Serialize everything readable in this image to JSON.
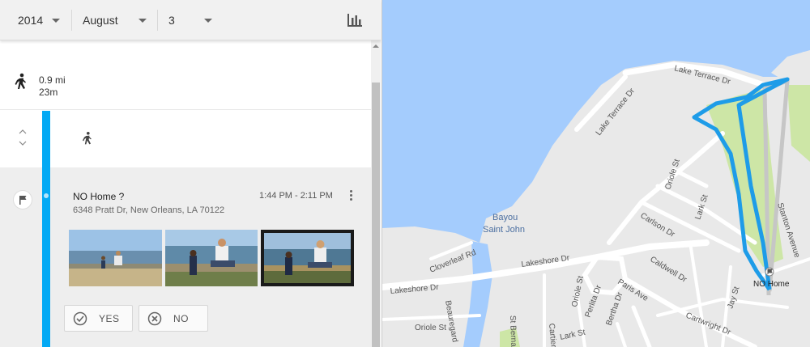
{
  "toolbar": {
    "year": "2014",
    "month": "August",
    "day": "3",
    "chart_icon": "bar-chart-icon"
  },
  "timeline": {
    "walk_segment": {
      "icon": "walk-icon",
      "distance": "0.9 mi",
      "duration": "23m"
    },
    "collapsed_segment": {
      "icon": "walk-icon"
    },
    "place": {
      "icon": "flag-icon",
      "name": "NO Home ?",
      "time_range": "1:44 PM - 2:11 PM",
      "address": "6348 Pratt Dr, New Orleans, LA 70122",
      "photos": [
        "photo-1",
        "photo-2",
        "photo-3"
      ],
      "yes_label": "YES",
      "no_label": "NO"
    }
  },
  "map": {
    "labels": {
      "lake_terrace_dr_top": "Lake Terrace Dr",
      "lake_terrace_dr_diag": "Lake Terrace Dr",
      "bayou": "Bayou",
      "saint_john": "Saint John",
      "lakeshore_dr_main": "Lakeshore Dr",
      "lakeshore_dr_left": "Lakeshore Dr",
      "cloverleaf": "Cloverleaf Rd",
      "beauregard": "Beauregard",
      "oriole_st_left": "Oriole St",
      "st_bernard": "St Bernard",
      "oriole_st": "Oriole St",
      "lark_st": "Lark St",
      "carlson_dr": "Carlson Dr",
      "caldwell_dr": "Caldwell Dr",
      "paris_ave": "Paris Ave",
      "perlita_dr": "Perlita Dr",
      "bertha_dr": "Bertha Dr",
      "oriole_st_bottom": "Oriole St",
      "lark_st_bottom": "Lark St",
      "cartwright_dr": "Cartwright Dr",
      "jay_st": "Jay St",
      "stanton_avenue": "Stanton Avenue",
      "cartier": "Cartier",
      "no_home_marker": "NO Home"
    },
    "colors": {
      "water": "#a4ccfd",
      "land": "#e9e9e9",
      "road": "#ffffff",
      "park": "#cde6a6",
      "route": "#1e9ce8",
      "route_alt": "#c9c9c9"
    }
  }
}
